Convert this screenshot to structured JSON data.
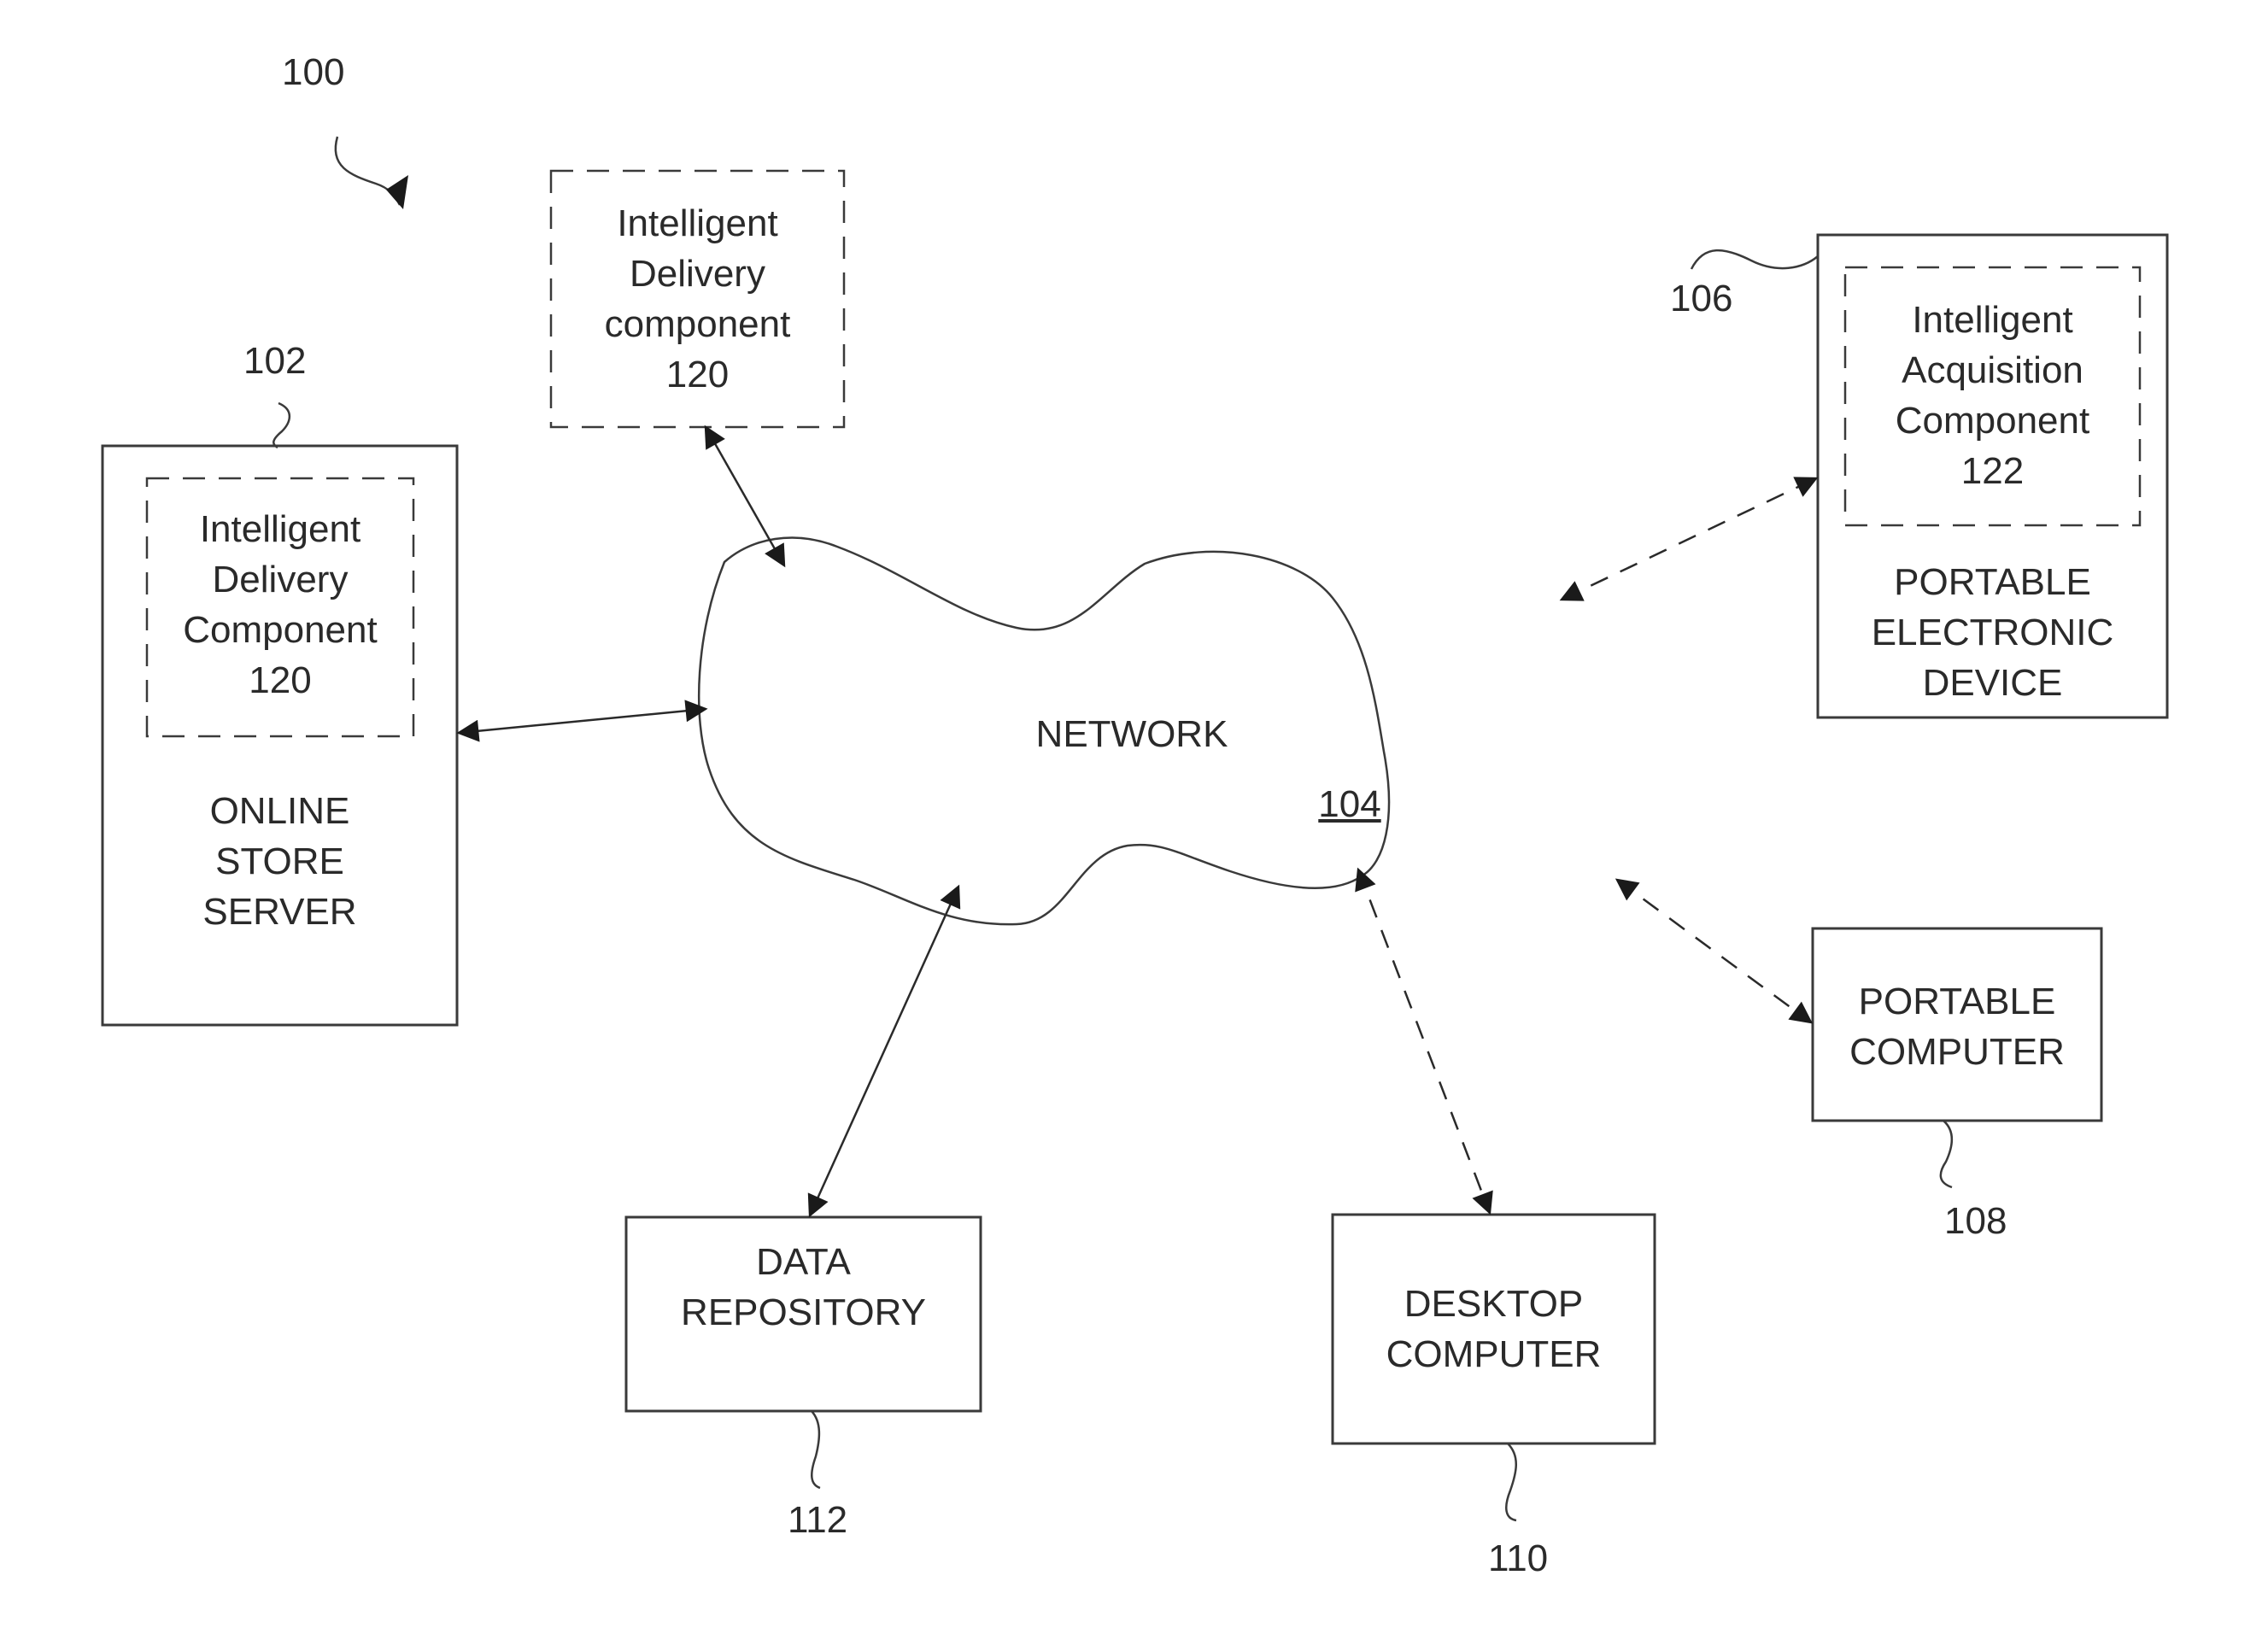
{
  "figure": {
    "ref": "100"
  },
  "network": {
    "label": "NETWORK",
    "ref": "104"
  },
  "online_store_server": {
    "ref": "102",
    "lines": [
      "ONLINE",
      "STORE",
      "SERVER"
    ],
    "component": {
      "lines": [
        "Intelligent",
        "Delivery",
        "Component",
        "120"
      ]
    }
  },
  "standalone_delivery_component": {
    "lines": [
      "Intelligent",
      "Delivery",
      "component",
      "120"
    ]
  },
  "portable_electronic_device": {
    "ref": "106",
    "lines": [
      "PORTABLE",
      "ELECTRONIC",
      "DEVICE"
    ],
    "component": {
      "lines": [
        "Intelligent",
        "Acquisition",
        "Component",
        "122"
      ]
    }
  },
  "portable_computer": {
    "ref": "108",
    "lines": [
      "PORTABLE",
      "COMPUTER"
    ]
  },
  "desktop_computer": {
    "ref": "110",
    "lines": [
      "DESKTOP",
      "COMPUTER"
    ]
  },
  "data_repository": {
    "ref": "112",
    "lines": [
      "DATA",
      "REPOSITORY"
    ]
  },
  "connections": [
    {
      "from": "standalone_delivery_component",
      "to": "network",
      "style": "solid",
      "bidirectional": true
    },
    {
      "from": "online_store_server",
      "to": "network",
      "style": "solid",
      "bidirectional": true
    },
    {
      "from": "portable_electronic_device",
      "to": "network",
      "style": "dashed",
      "bidirectional": true
    },
    {
      "from": "portable_computer",
      "to": "network",
      "style": "dashed",
      "bidirectional": true
    },
    {
      "from": "desktop_computer",
      "to": "network",
      "style": "dashed",
      "bidirectional": true
    },
    {
      "from": "data_repository",
      "to": "network",
      "style": "solid",
      "bidirectional": true
    }
  ],
  "colors": {
    "line": "#3a3a3a",
    "text": "#2a2a2a",
    "background": "#ffffff"
  }
}
